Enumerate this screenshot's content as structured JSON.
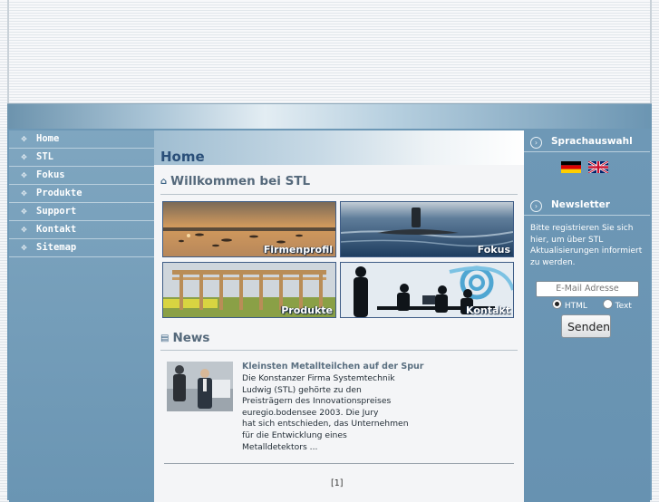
{
  "nav": {
    "items": [
      {
        "label": "Home"
      },
      {
        "label": "STL"
      },
      {
        "label": "Fokus"
      },
      {
        "label": "Produkte"
      },
      {
        "label": "Support"
      },
      {
        "label": "Kontakt"
      },
      {
        "label": "Sitemap"
      }
    ]
  },
  "main": {
    "title": "Home",
    "welcome": "Willkommen bei STL",
    "tiles": [
      {
        "caption": "Firmenprofil"
      },
      {
        "caption": "Fokus"
      },
      {
        "caption": "Produkte"
      },
      {
        "caption": "Kontakt"
      }
    ],
    "news": {
      "heading": "News",
      "item_title": "Kleinsten Metallteilchen auf der Spur",
      "item_lines": [
        "Die Konstanzer Firma Systemtechnik",
        "Ludwig (STL) gehörte zu den",
        "Preisträgern des Innovationspreises",
        "euregio.bodensee 2003. Die Jury",
        "hat sich entschieden, das Unternehmen",
        "für die Entwicklung eines",
        "Metalldetektors ..."
      ],
      "pager": "[1]"
    }
  },
  "right": {
    "language_heading": "Sprachauswahl",
    "newsletter_heading": "Newsletter",
    "newsletter_text": "Bitte registrieren Sie sich hier, um über STL Aktualisierungen informiert zu werden.",
    "email_placeholder": "E-Mail Adresse",
    "format_html": "HTML",
    "format_text": "Text",
    "format_selected": "HTML",
    "send_label": "Senden"
  },
  "icons": {
    "nav_bullet": "diamond-grid-icon",
    "section_home": "house-icon",
    "section_news": "document-icon",
    "right_heading": "arrow-circle-icon"
  },
  "colors": {
    "title_blue": "#2a4f79",
    "panel_blue": "#6d98b6",
    "content_bg": "#f4f5f7"
  }
}
